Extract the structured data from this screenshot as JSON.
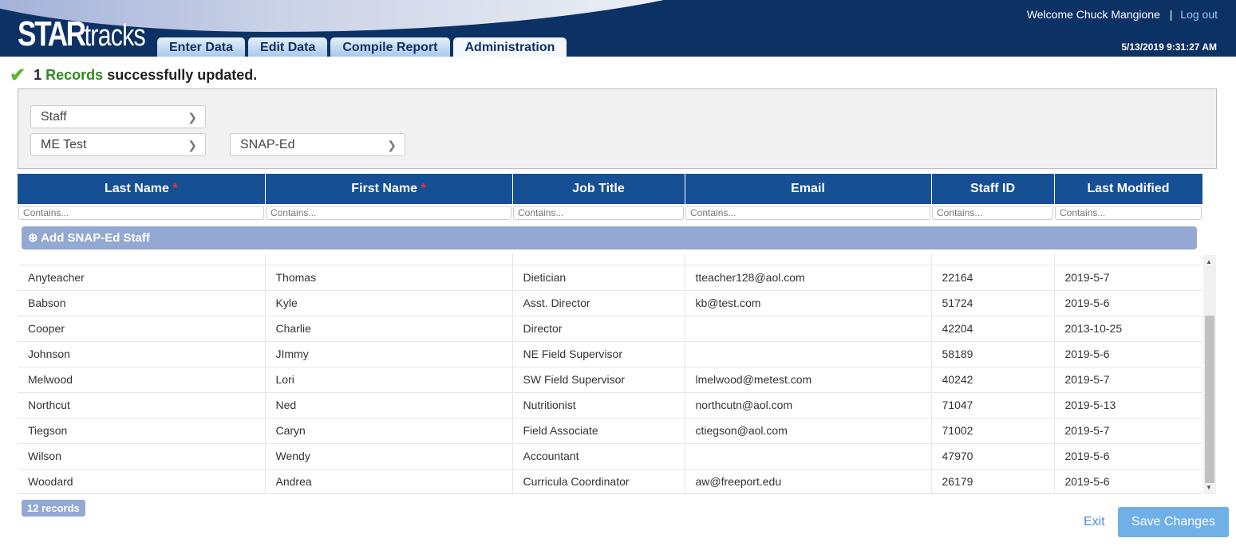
{
  "header": {
    "logo_text": "STARtracks",
    "welcome": "Welcome Chuck Mangione",
    "separator": "|",
    "logout": "Log out",
    "datetime": "5/13/2019 9:31:27 AM",
    "tabs": [
      {
        "label": "Enter Data"
      },
      {
        "label": "Edit Data"
      },
      {
        "label": "Compile Report"
      },
      {
        "label": "Administration",
        "active": true
      }
    ]
  },
  "message": {
    "count": "1",
    "records": "Records",
    "text": "successfully updated."
  },
  "filters": {
    "type": "Staff",
    "agency": "ME Test",
    "program": "SNAP-Ed"
  },
  "table": {
    "columns": [
      "Last Name",
      "First Name",
      "Job Title",
      "Email",
      "Staff ID",
      "Last Modified"
    ],
    "required_mark": "*",
    "filter_placeholder": "Contains...",
    "add_label": "Add SNAP-Ed Staff",
    "rows": [
      [
        "",
        "",
        "",
        "",
        "",
        ""
      ],
      [
        "Anyteacher",
        "Thomas",
        "Dietician",
        "tteacher128@aol.com",
        "22164",
        "2019-5-7"
      ],
      [
        "Babson",
        "Kyle",
        "Asst. Director",
        "kb@test.com",
        "51724",
        "2019-5-6"
      ],
      [
        "Cooper",
        "Charlie",
        "Director",
        "",
        "42204",
        "2013-10-25"
      ],
      [
        "Johnson",
        "JImmy",
        "NE Field Supervisor",
        "",
        "58189",
        "2019-5-6"
      ],
      [
        "Melwood",
        "Lori",
        "SW Field Supervisor",
        "lmelwood@metest.com",
        "40242",
        "2019-5-7"
      ],
      [
        "Northcut",
        "Ned",
        "Nutritionist",
        "northcutn@aol.com",
        "71047",
        "2019-5-13"
      ],
      [
        "Tiegson",
        "Caryn",
        "Field Associate",
        "ctiegson@aol.com",
        "71002",
        "2019-5-7"
      ],
      [
        "Wilson",
        "Wendy",
        "Accountant",
        "",
        "47970",
        "2019-5-6"
      ],
      [
        "Woodard",
        "Andrea",
        "Curricula Coordinator",
        "aw@freeport.edu",
        "26179",
        "2019-5-6"
      ]
    ]
  },
  "footer": {
    "record_count": "12 records",
    "exit": "Exit",
    "save": "Save Changes"
  },
  "colors": {
    "header_bg": "#0c3265",
    "table_header": "#164f94",
    "add_bar": "#93a8d2",
    "success_green": "#2e8b1f",
    "save_button": "#70b0e8"
  }
}
